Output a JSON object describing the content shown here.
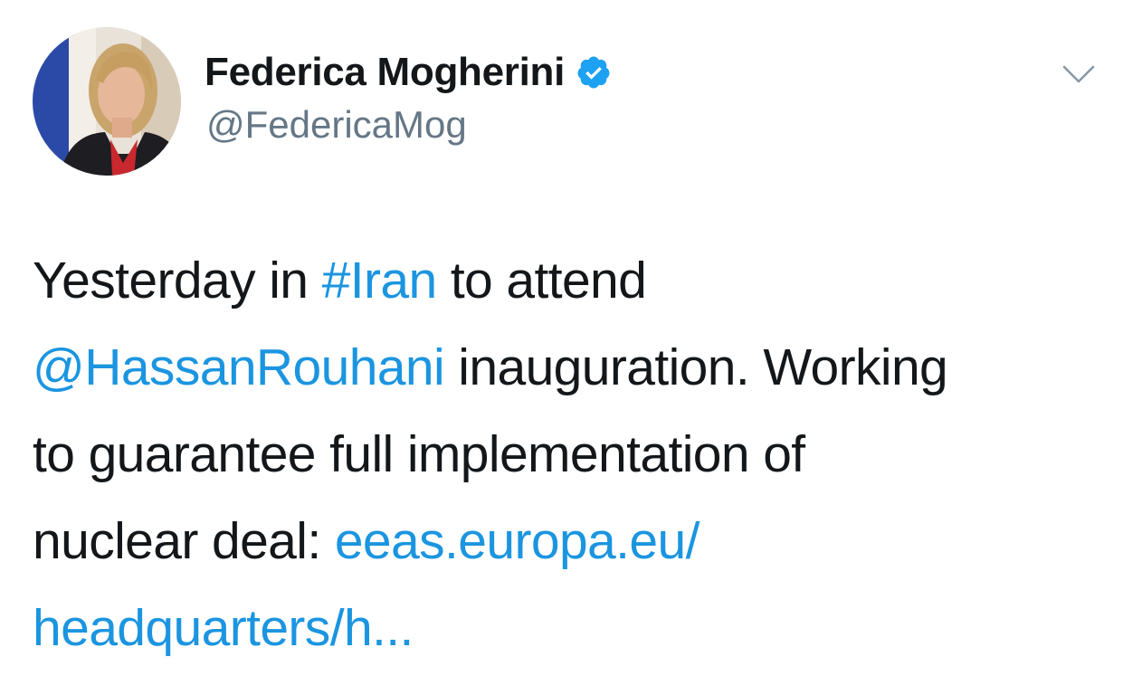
{
  "author": {
    "display_name": "Federica Mogherini",
    "handle": "@FedericaMog",
    "verified": true,
    "avatar_icon": "user-avatar-photo"
  },
  "menu": {
    "icon": "chevron-down-icon"
  },
  "tweet": {
    "lines": [
      [
        {
          "text": "Yesterday in ",
          "type": "text"
        },
        {
          "text": "#Iran",
          "type": "hashtag"
        },
        {
          "text": " to attend",
          "type": "text"
        }
      ],
      [
        {
          "text": "@HassanRouhani",
          "type": "mention"
        },
        {
          "text": " inauguration. Working",
          "type": "text"
        }
      ],
      [
        {
          "text": "to guarantee full implementation of",
          "type": "text"
        }
      ],
      [
        {
          "text": "nuclear deal: ",
          "type": "text"
        },
        {
          "text": "eeas.europa.eu/",
          "type": "url"
        }
      ],
      [
        {
          "text": "headquarters/h...",
          "type": "url"
        }
      ]
    ]
  },
  "colors": {
    "link": "#1b95e0",
    "verified_badge": "#1da1f2",
    "text": "#14171a",
    "secondary_text": "#657786"
  }
}
